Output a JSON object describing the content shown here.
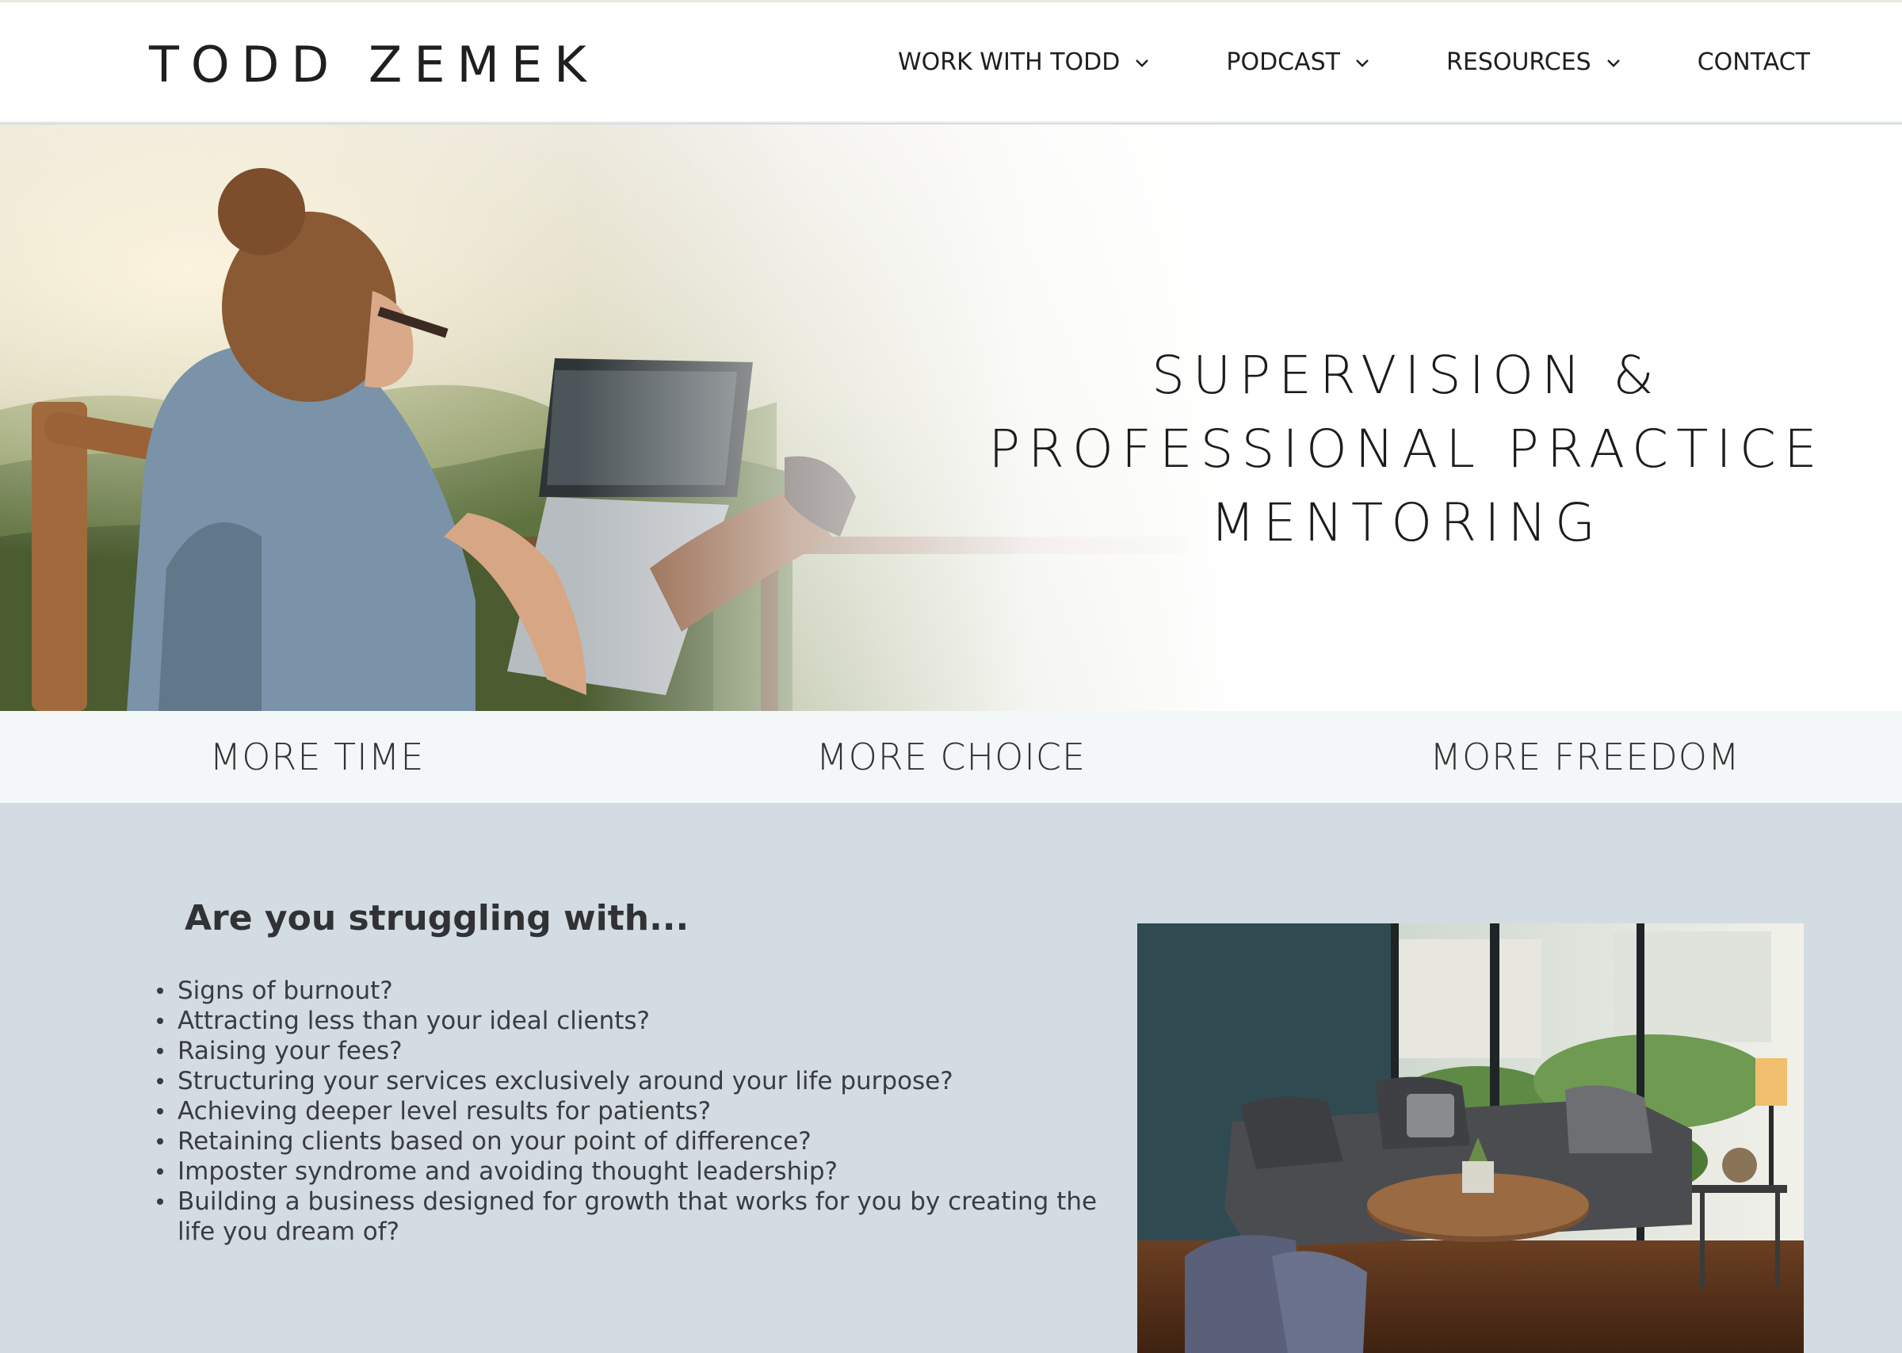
{
  "header": {
    "logo": "TODD ZEMEK",
    "nav": [
      {
        "label": "WORK WITH TODD",
        "icon": "chevron-down-icon"
      },
      {
        "label": "PODCAST",
        "icon": "chevron-down-icon"
      },
      {
        "label": "RESOURCES",
        "icon": "chevron-down-icon"
      },
      {
        "label": "CONTACT"
      }
    ]
  },
  "hero": {
    "title_lines": [
      "SUPERVISION &",
      "PROFESSIONAL PRACTICE",
      "MENTORING"
    ],
    "image": "woman-with-laptop-on-balcony"
  },
  "pillars": [
    "MORE TIME",
    "MORE CHOICE",
    "MORE FREEDOM"
  ],
  "struggling": {
    "heading": "Are you struggling with...",
    "items": [
      "Signs of burnout?",
      "Attracting less than your ideal clients?",
      "Raising your fees?",
      "Structuring your services exclusively around your life purpose?",
      "Achieving deeper level results for patients?",
      "Retaining clients based on your point of difference?",
      "Imposter syndrome and avoiding thought leadership?",
      "Building a business designed for growth that works for you by creating the life you dream of?"
    ],
    "image": "therapy-room-with-sofa"
  },
  "colors": {
    "section_bg": "#d3dce2",
    "pillar_bg": "#f4f7f8",
    "text_dark": "#1f1f1f"
  }
}
